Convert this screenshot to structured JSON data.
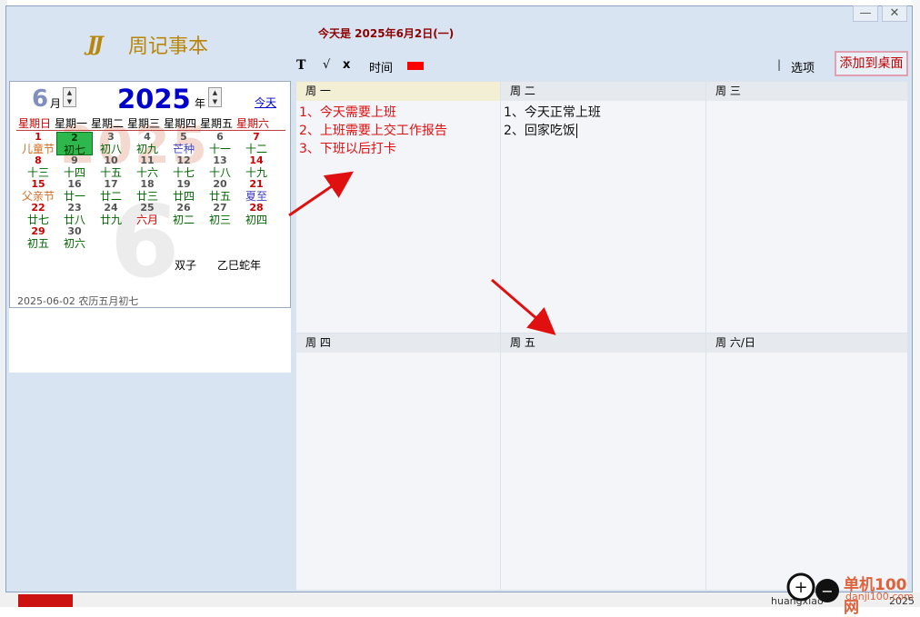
{
  "window": {
    "minimize": "—",
    "close": "✕"
  },
  "app": {
    "logo_mark": "JJ",
    "title": "周记事本",
    "today_text": "今天是 2025年6月2日(一)"
  },
  "toolbar": {
    "bold": "T",
    "check": "√",
    "cross": "x",
    "time": "时间",
    "color_swatch": "#ff0000",
    "separator": "|",
    "options": "选项",
    "add_to_desktop": "添加到桌面"
  },
  "calendar": {
    "month": "6",
    "month_char": "月",
    "year": "2025",
    "year_char": "年",
    "today_link": "今天",
    "watermark_year": "2025",
    "watermark_month": "6",
    "weekdays": [
      "星期日",
      "星期一",
      "星期二",
      "星期三",
      "星期四",
      "星期五",
      "星期六"
    ],
    "days": [
      {
        "n": "1",
        "l": "儿童节",
        "nc": "red",
        "lc": "orange"
      },
      {
        "n": "2",
        "l": "初七",
        "sel": true
      },
      {
        "n": "3",
        "l": "初八"
      },
      {
        "n": "4",
        "l": "初九"
      },
      {
        "n": "5",
        "l": "芒种",
        "lc": "blue"
      },
      {
        "n": "6",
        "l": "十一"
      },
      {
        "n": "7",
        "l": "十二",
        "nc": "red"
      },
      {
        "n": "8",
        "l": "十三",
        "nc": "red"
      },
      {
        "n": "9",
        "l": "十四"
      },
      {
        "n": "10",
        "l": "十五"
      },
      {
        "n": "11",
        "l": "十六"
      },
      {
        "n": "12",
        "l": "十七"
      },
      {
        "n": "13",
        "l": "十八"
      },
      {
        "n": "14",
        "l": "十九",
        "nc": "red"
      },
      {
        "n": "15",
        "l": "父亲节",
        "nc": "red",
        "lc": "orange"
      },
      {
        "n": "16",
        "l": "廿一"
      },
      {
        "n": "17",
        "l": "廿二"
      },
      {
        "n": "18",
        "l": "廿三"
      },
      {
        "n": "19",
        "l": "廿四"
      },
      {
        "n": "20",
        "l": "廿五"
      },
      {
        "n": "21",
        "l": "夏至",
        "nc": "red",
        "lc": "blue"
      },
      {
        "n": "22",
        "l": "廿七",
        "nc": "red"
      },
      {
        "n": "23",
        "l": "廿八"
      },
      {
        "n": "24",
        "l": "廿九"
      },
      {
        "n": "25",
        "l": "六月",
        "lc": "red"
      },
      {
        "n": "26",
        "l": "初二"
      },
      {
        "n": "27",
        "l": "初三"
      },
      {
        "n": "28",
        "l": "初四",
        "nc": "red"
      },
      {
        "n": "29",
        "l": "初五",
        "nc": "red"
      },
      {
        "n": "30",
        "l": "初六"
      }
    ],
    "zodiac": "双子",
    "ganzhi": "乙巳蛇年",
    "footer": "2025-06-02  农历五月初七"
  },
  "week": {
    "mon": {
      "label": "周 一",
      "notes": [
        "1、今天需要上班",
        "2、上班需要上交工作报告",
        "3、下班以后打卡"
      ]
    },
    "tue": {
      "label": "周 二",
      "notes": [
        "1、今天正常上班",
        "2、回家吃饭"
      ]
    },
    "wed": {
      "label": "周 三"
    },
    "thu": {
      "label": "周 四"
    },
    "fri": {
      "label": "周 五"
    },
    "sat_sun": {
      "label": "周 六/日"
    }
  },
  "watermark": {
    "site_name": "单机100网",
    "site_url": "danji100.com"
  },
  "background": {
    "user": "huangxiao",
    "year": "2025"
  },
  "colors": {
    "panel_bg": "#d9e4f2",
    "arrow": "#e01010",
    "selected_day": "#2db84d"
  }
}
